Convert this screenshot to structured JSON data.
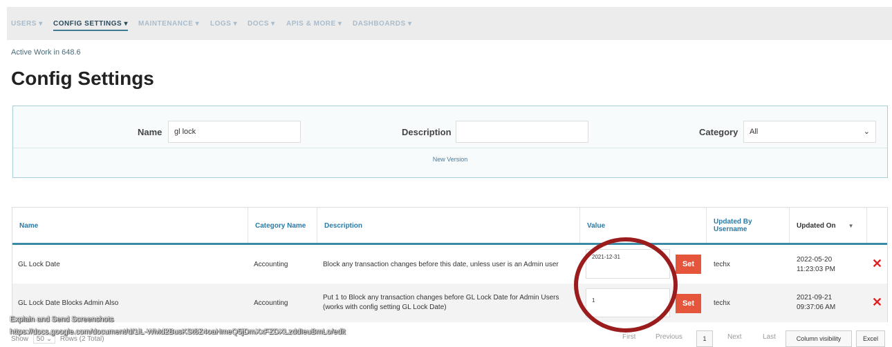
{
  "nav": {
    "items": [
      "USERS ▾",
      "CONFIG SETTINGS ▾",
      "MAINTENANCE ▾",
      "LOGS ▾",
      "DOCS ▾",
      "APIS & MORE ▾",
      "DASHBOARDS ▾"
    ],
    "active": "CONFIG SETTINGS ▾"
  },
  "breadcrumb": "Active Work in 648.6",
  "page_title": "Config Settings",
  "filter": {
    "name_label": "Name",
    "name_value": "gl lock",
    "description_label": "Description",
    "description_value": "",
    "category_label": "Category",
    "category_value": "All",
    "new_version": "New Version"
  },
  "table": {
    "columns": [
      "Name",
      "Category Name",
      "Description",
      "Value",
      "Updated By Username",
      "Updated On"
    ],
    "rows": [
      {
        "name": "GL Lock Date",
        "category": "Accounting",
        "description": "Block any transaction changes before this date, unless user is an Admin user",
        "value": "2021-12-31",
        "set": "Set",
        "updated_by": "techx",
        "updated_on_date": "2022-05-20",
        "updated_on_time": "11:23:03 PM"
      },
      {
        "name": "GL Lock Date Blocks Admin Also",
        "category": "Accounting",
        "description": "Put 1 to Block any transaction changes before GL Lock Date for Admin Users (works with config setting GL Lock Date)",
        "value": "1",
        "set": "Set",
        "updated_by": "techx",
        "updated_on_date": "2021-09-21",
        "updated_on_time": "09:37:06 AM"
      }
    ]
  },
  "footer": {
    "show": "Show",
    "page_size": "50",
    "rows_total": "Rows (2 Total)",
    "first": "First",
    "previous": "Previous",
    "page": "1",
    "next": "Next",
    "last": "Last",
    "column_visibility": "Column visibility",
    "excel": "Excel"
  },
  "overlay": {
    "title": "Explain and Send Screenshots",
    "url": "https://docs.google.com/document/d/1iL-WMd2BusKSt8Z4oaHmeQ5jDmXxFZDXLzddIeuBmLo/edit"
  },
  "colors": {
    "accent": "#2a7aa5",
    "set_button": "#e5553b",
    "delete": "#e02020",
    "annotation_circle": "#9b1c1c"
  }
}
